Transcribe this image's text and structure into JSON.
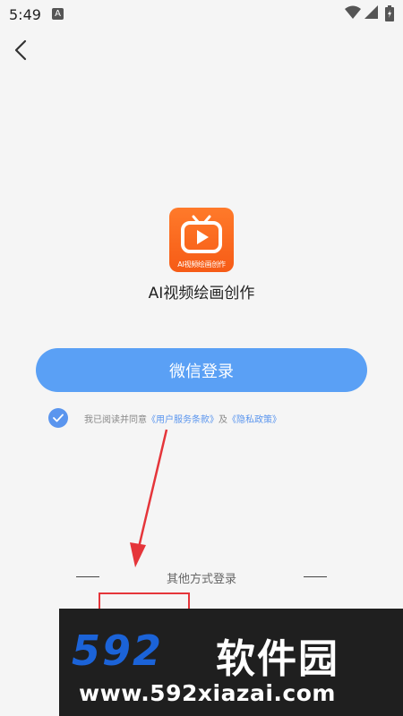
{
  "status_bar": {
    "time": "5:49",
    "notification_letter": "A"
  },
  "app": {
    "logo_caption": "AI视频绘画创作",
    "name": "AI视频绘画创作"
  },
  "login": {
    "wechat_button": "微信登录",
    "agree_prefix": "我已阅读并同意",
    "terms_link": "《用户服务条款》",
    "and_text": "及",
    "privacy_link": "《隐私政策》",
    "agree_checked": true
  },
  "other_methods": {
    "label": "其他方式登录"
  },
  "watermark": {
    "brand_number": "592",
    "brand_name": "软件园",
    "url": "www.592xiazai.com"
  },
  "colors": {
    "primary": "#5aa0f5",
    "link": "#5a95ee",
    "logo": "#f65b16",
    "annotation": "#e5353a"
  }
}
